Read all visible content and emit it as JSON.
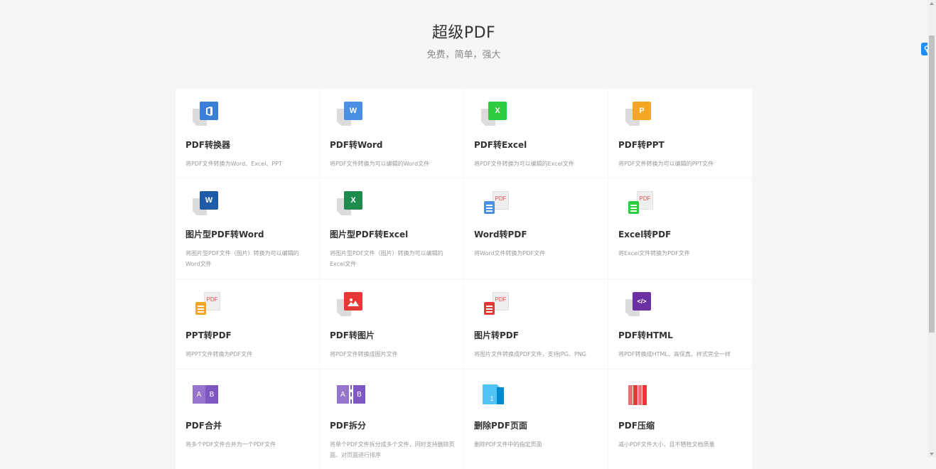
{
  "header": {
    "title": "超级PDF",
    "subtitle": "免费，简单，强大"
  },
  "colors": {
    "office": "#3a7fd8",
    "word": "#4a90e2",
    "excel": "#2ecc40",
    "ppt": "#f5a623",
    "word_dark": "#1f5ca8",
    "excel_dark": "#1e8b4d",
    "html": "#6a2fa3",
    "image": "#e53935",
    "merge": "#7e57c2",
    "delete": "#4fc3f7",
    "compress": "#e53935"
  },
  "tools": [
    {
      "title": "PDF转换器",
      "desc": "将PDF文件转换为Word、Excel、PPT",
      "icon": "office-icon"
    },
    {
      "title": "PDF转Word",
      "desc": "将PDF文件转换为可以编辑的Word文件",
      "icon": "word-icon",
      "glyph": "W"
    },
    {
      "title": "PDF转Excel",
      "desc": "将PDF文件转换为可以编辑的Excel文件",
      "icon": "excel-icon",
      "glyph": "X"
    },
    {
      "title": "PDF转PPT",
      "desc": "将PDF文件转换为可以编辑的PPT文件",
      "icon": "ppt-icon",
      "glyph": "P"
    },
    {
      "title": "图片型PDF转Word",
      "desc": "将图片型PDF文件（图片）转换为可以编辑的Word文件",
      "icon": "word-icon",
      "glyph": "W"
    },
    {
      "title": "图片型PDF转Excel",
      "desc": "将图片型PDF文件（图片）转换为可以编辑的Excel文件",
      "icon": "excel-icon",
      "glyph": "X"
    },
    {
      "title": "Word转PDF",
      "desc": "将Word文件转换为PDF文件",
      "icon": "word-to-pdf-icon",
      "badge": "PDF"
    },
    {
      "title": "Excel转PDF",
      "desc": "将Excel文件转换为PDF文件",
      "icon": "excel-to-pdf-icon",
      "badge": "PDF"
    },
    {
      "title": "PPT转PDF",
      "desc": "将PPT文件转换为PDF文件",
      "icon": "ppt-to-pdf-icon",
      "badge": "PDF"
    },
    {
      "title": "PDF转图片",
      "desc": "将PDF文件转换成图片文件",
      "icon": "image-icon"
    },
    {
      "title": "图片转PDF",
      "desc": "将图片文件转换成PDF文件，支持JPG、PNG",
      "icon": "image-to-pdf-icon",
      "badge": "PDF"
    },
    {
      "title": "PDF转HTML",
      "desc": "将PDF转换成HTML、高保真、样式完全一样",
      "icon": "html-icon",
      "glyph": "</>"
    },
    {
      "title": "PDF合并",
      "desc": "将多个PDF文件合并为一个PDF文件",
      "icon": "merge-icon",
      "glyph_a": "A",
      "glyph_b": "B"
    },
    {
      "title": "PDF拆分",
      "desc": "将单个PDF文件拆分成多个文件，同时支持删除页面、对页面进行排序",
      "icon": "split-icon",
      "glyph_a": "A",
      "glyph_b": "B"
    },
    {
      "title": "删除PDF页面",
      "desc": "删除PDF文件中的指定页面",
      "icon": "delete-page-icon",
      "glyph": "1"
    },
    {
      "title": "PDF压缩",
      "desc": "减小PDF文件大小，且不牺牲文档质量",
      "icon": "compress-icon"
    }
  ],
  "float_button": {
    "icon": "cloud-icon"
  }
}
